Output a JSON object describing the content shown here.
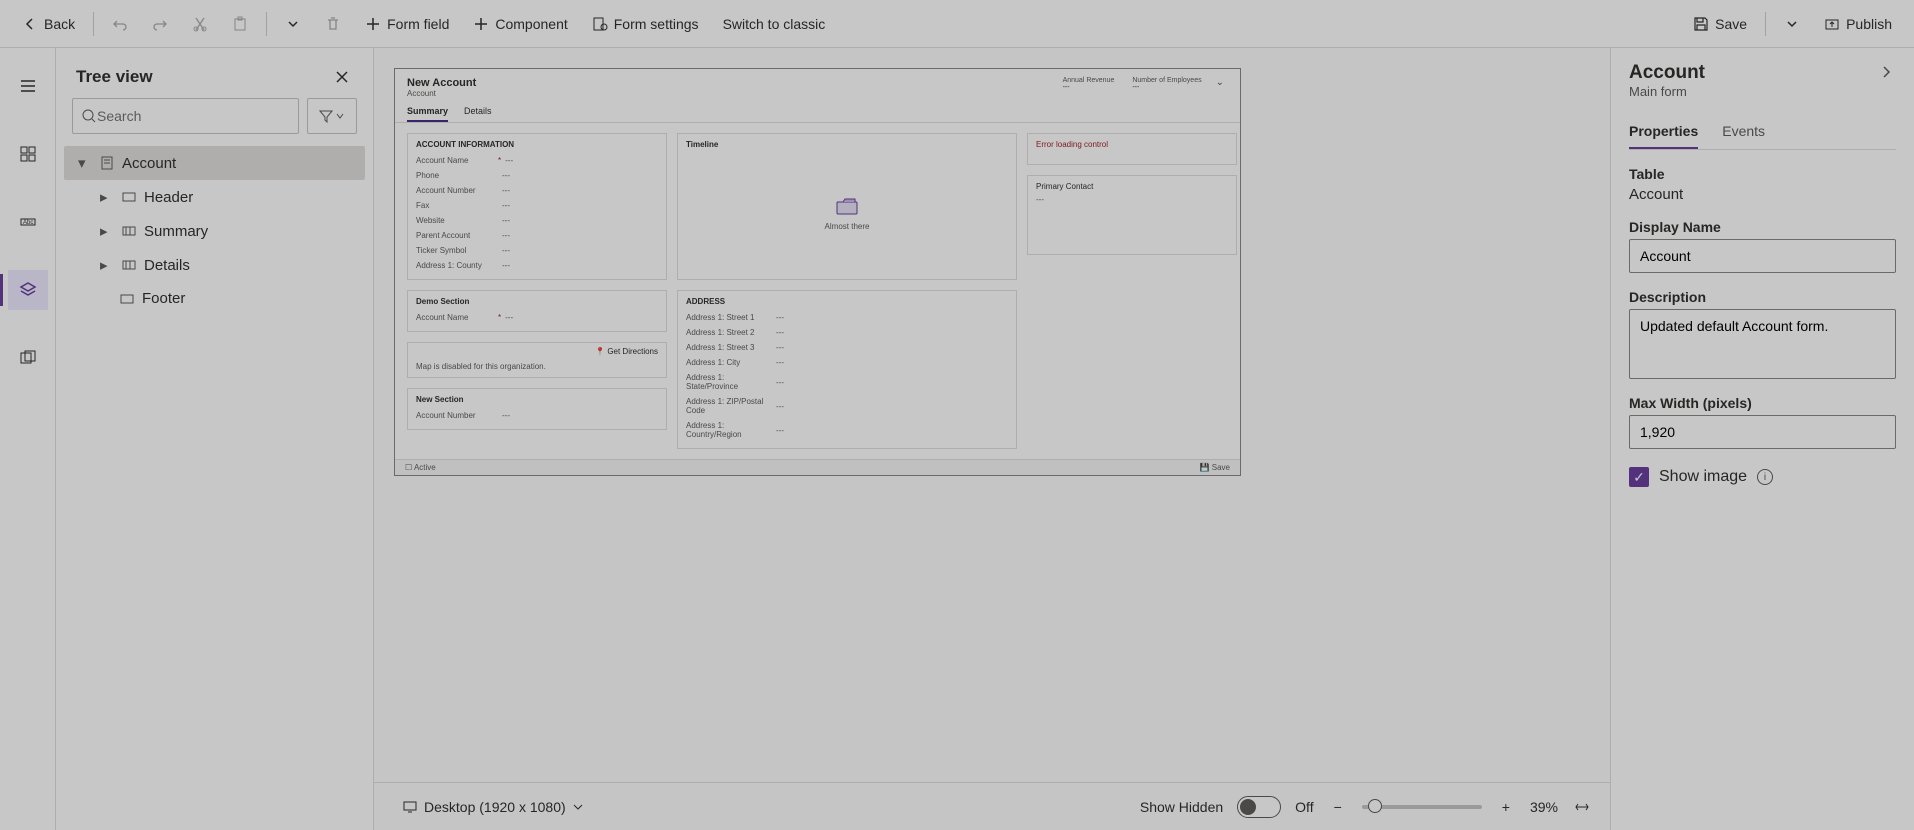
{
  "toolbar": {
    "back": "Back",
    "form_field": "Form field",
    "component": "Component",
    "form_settings": "Form settings",
    "switch_classic": "Switch to classic",
    "save": "Save",
    "publish": "Publish"
  },
  "tree": {
    "title": "Tree view",
    "search_placeholder": "Search",
    "root": "Account",
    "items": [
      "Header",
      "Summary",
      "Details",
      "Footer"
    ]
  },
  "preview": {
    "title": "New Account",
    "subtitle": "Account",
    "header_fields": [
      {
        "label": "Annual Revenue",
        "value": "---"
      },
      {
        "label": "Number of Employees",
        "value": "---"
      }
    ],
    "tabs": [
      "Summary",
      "Details"
    ],
    "col1": {
      "s1title": "ACCOUNT INFORMATION",
      "s1fields": [
        {
          "label": "Account Name",
          "req": "*",
          "value": "---"
        },
        {
          "label": "Phone",
          "req": "",
          "value": "---"
        },
        {
          "label": "Account Number",
          "req": "",
          "value": "---"
        },
        {
          "label": "Fax",
          "req": "",
          "value": "---"
        },
        {
          "label": "Website",
          "req": "",
          "value": "---"
        },
        {
          "label": "Parent Account",
          "req": "",
          "value": "---"
        },
        {
          "label": "Ticker Symbol",
          "req": "",
          "value": "---"
        },
        {
          "label": "Address 1: County",
          "req": "",
          "value": "---"
        }
      ],
      "s2title": "Demo Section",
      "s2fields": [
        {
          "label": "Account Name",
          "req": "*",
          "value": "---"
        }
      ],
      "dirs": "Get Directions",
      "map_msg": "Map is disabled for this organization.",
      "s3title": "New Section",
      "s3fields": [
        {
          "label": "Account Number",
          "req": "",
          "value": "---"
        }
      ]
    },
    "col2": {
      "tl_title": "Timeline",
      "tl_msg": "Almost there",
      "addr_title": "ADDRESS",
      "addr_fields": [
        {
          "label": "Address 1: Street 1",
          "value": "---"
        },
        {
          "label": "Address 1: Street 2",
          "value": "---"
        },
        {
          "label": "Address 1: Street 3",
          "value": "---"
        },
        {
          "label": "Address 1: City",
          "value": "---"
        },
        {
          "label": "Address 1: State/Province",
          "value": "---"
        },
        {
          "label": "Address 1: ZIP/Postal Code",
          "value": "---"
        },
        {
          "label": "Address 1: Country/Region",
          "value": "---"
        }
      ]
    },
    "col3": {
      "err": "Error loading control",
      "pc_title": "Primary Contact",
      "pc_value": "---"
    },
    "footer": {
      "left": "Active",
      "right": "Save"
    }
  },
  "status": {
    "viewport": "Desktop (1920 x 1080)",
    "show_hidden": "Show Hidden",
    "toggle_label": "Off",
    "zoom": "39%"
  },
  "props": {
    "title": "Account",
    "subtitle": "Main form",
    "tabs": [
      "Properties",
      "Events"
    ],
    "table_label": "Table",
    "table_value": "Account",
    "dn_label": "Display Name",
    "dn_value": "Account",
    "desc_label": "Description",
    "desc_value": "Updated default Account form.",
    "mw_label": "Max Width (pixels)",
    "mw_value": "1,920",
    "show_image": "Show image"
  }
}
